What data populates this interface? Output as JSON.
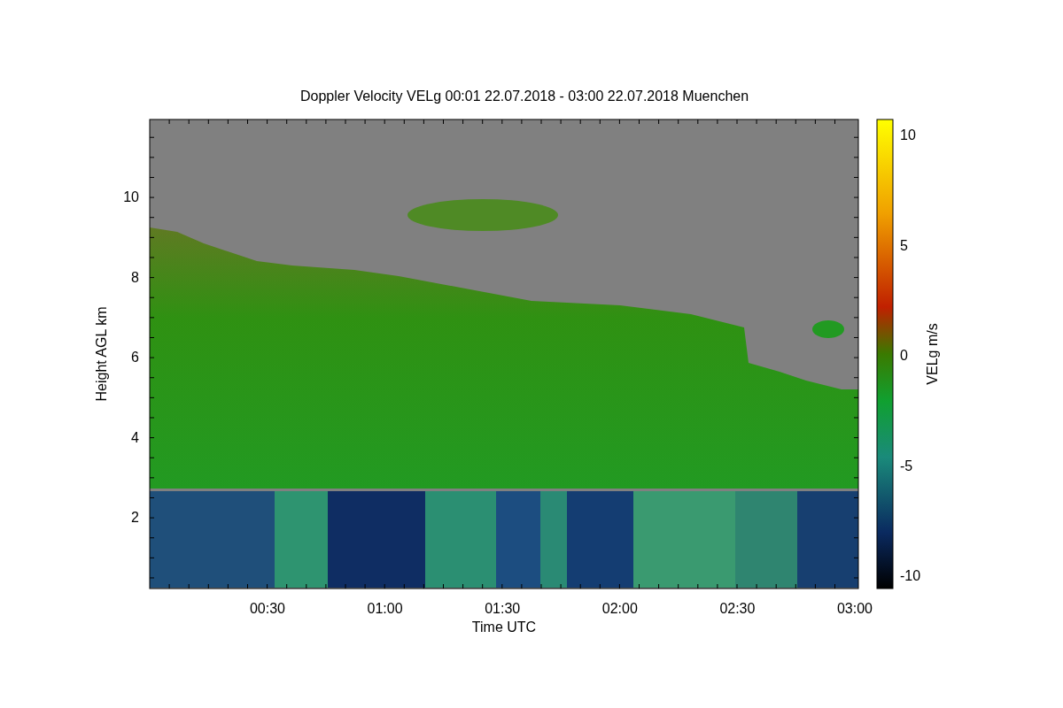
{
  "title": "Doppler Velocity VELg   00:01 22.07.2018 - 03:00 22.07.2018 Muenchen",
  "y_axis": {
    "label": "Height AGL km",
    "ticks": [
      "10",
      "8",
      "6",
      "4",
      "2"
    ]
  },
  "x_axis": {
    "label": "Time UTC",
    "ticks": [
      "00:30",
      "01:00",
      "01:30",
      "02:00",
      "02:30",
      "03:00"
    ]
  },
  "colorbar": {
    "label": "VELg m/s",
    "ticks": [
      "10",
      "5",
      "0",
      "-5",
      "-10"
    ]
  }
}
